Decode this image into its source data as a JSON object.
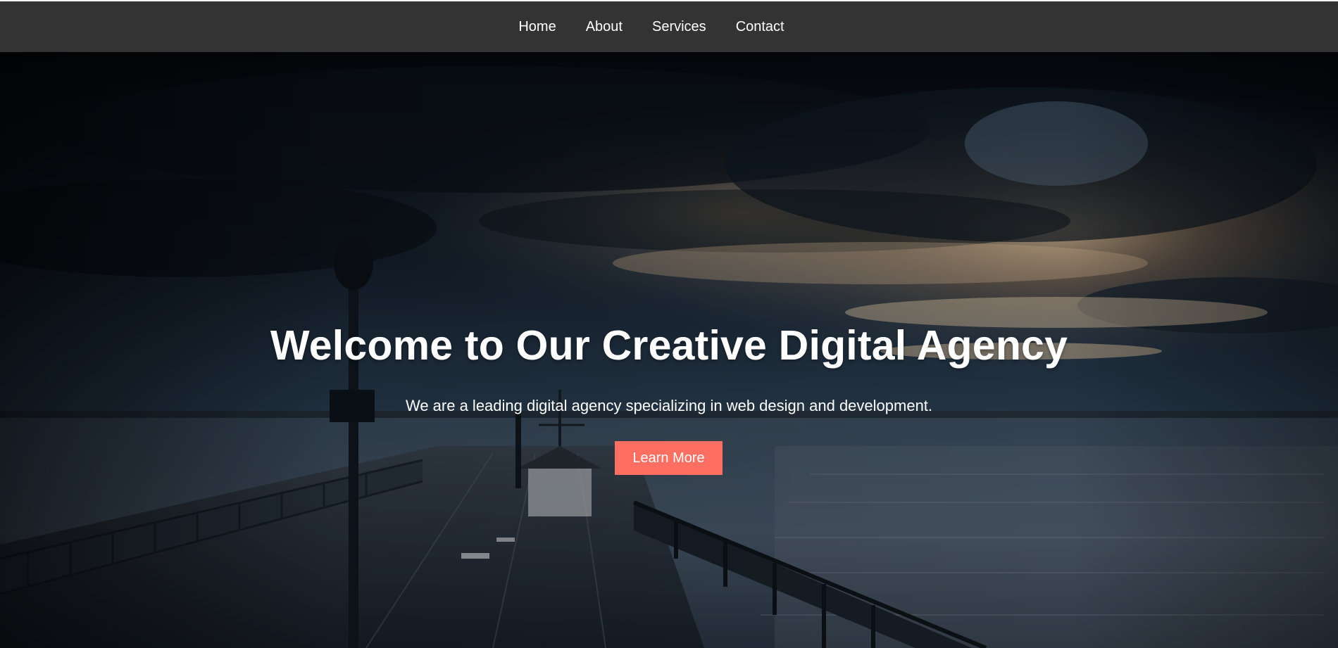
{
  "nav": {
    "items": [
      {
        "label": "Home"
      },
      {
        "label": "About"
      },
      {
        "label": "Services"
      },
      {
        "label": "Contact"
      }
    ]
  },
  "hero": {
    "title": "Welcome to Our Creative Digital Agency",
    "subtitle": "We are a leading digital agency specializing in web design and development.",
    "cta_label": "Learn More",
    "background_image": "hero-pier-sunset"
  },
  "colors": {
    "topbar": "#333333",
    "text": "#ffffff",
    "cta": "#ff6f61"
  }
}
